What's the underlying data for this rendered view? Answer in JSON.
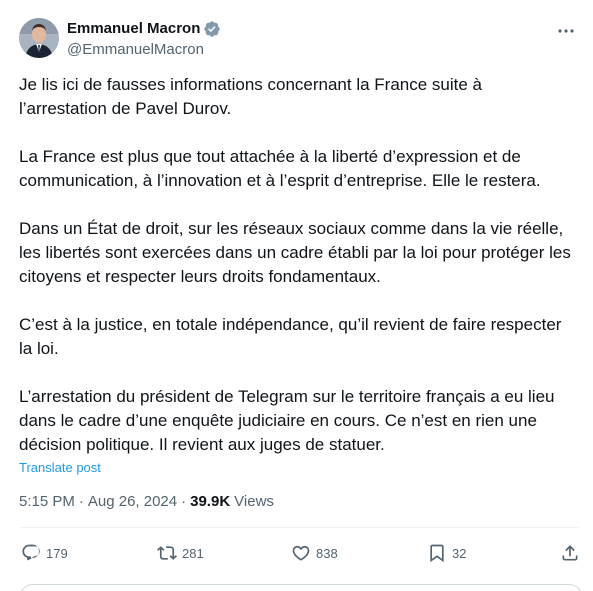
{
  "author": {
    "display_name": "Emmanuel Macron",
    "handle": "@EmmanuelMacron",
    "verified": true
  },
  "post": {
    "paragraphs": [
      "Je lis ici de fausses informations concernant la France suite à\nl’arrestation de Pavel Durov.",
      "La France est plus que tout attachée à la liberté d’expression et de\ncommunication, à l’innovation et à l’esprit d’entreprise. Elle le restera.",
      "Dans un État de droit, sur les réseaux sociaux comme dans la vie réelle,\nles libertés sont exercées dans un cadre établi par la loi pour protéger les\ncitoyens et respecter leurs droits fondamentaux.",
      "C’est à la justice, en totale indépendance, qu’il revient de faire respecter\nla loi.",
      "L’arrestation du président de Telegram sur le territoire français a eu lieu\ndans le cadre d’une enquête judiciaire en cours. Ce n’est en rien une\ndécision politique. Il revient aux juges de statuer."
    ],
    "translate_label": "Translate post",
    "time": "5:15 PM",
    "separator": "·",
    "date": "Aug 26, 2024",
    "views_count": "39.9K",
    "views_label": "Views"
  },
  "actions": {
    "replies": "179",
    "reposts": "281",
    "likes": "838",
    "bookmarks": "32"
  },
  "icons": {
    "verified": "verified-badge-icon",
    "more": "more-dots-icon",
    "reply": "reply-icon",
    "repost": "repost-icon",
    "like": "heart-icon",
    "bookmark": "bookmark-icon",
    "share": "share-icon"
  },
  "colors": {
    "accent": "#1d9bf0",
    "text_primary": "#0f1419",
    "text_secondary": "#536471"
  }
}
